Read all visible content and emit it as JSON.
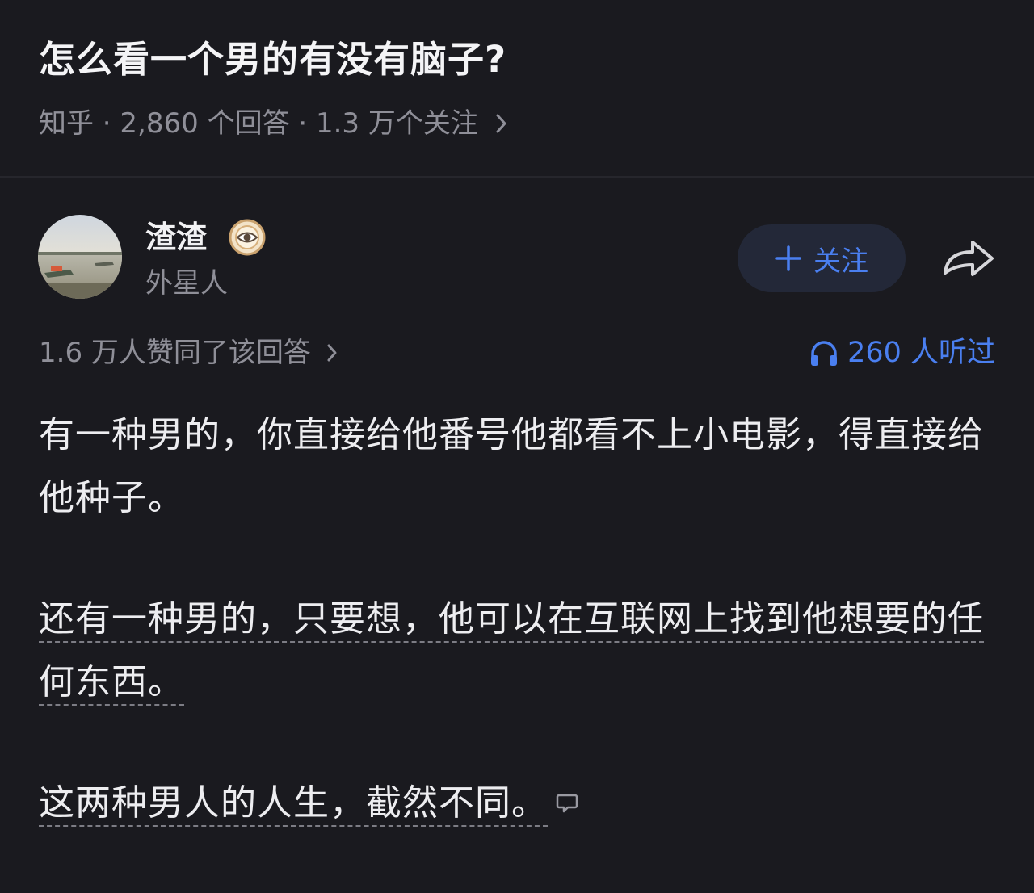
{
  "question": {
    "title": "怎么看一个男的有没有脑子?",
    "meta": "知乎 · 2,860 个回答 · 1.3 万个关注"
  },
  "author": {
    "name": "渣渣",
    "bio": "外星人"
  },
  "actions": {
    "follow_label": "关注"
  },
  "stats": {
    "agree": "1.6 万人赞同了该回答",
    "listen": "260 人听过"
  },
  "answer": {
    "paragraph1": "有一种男的，你直接给他番号他都看不上小电影，得直接给他种子。",
    "paragraph2": "还有一种男的，只要想，他可以在互联网上找到他想要的任何东西。",
    "paragraph3": "这两种男人的人生，截然不同。"
  },
  "colors": {
    "background": "#1a1a1f",
    "accent": "#4a7ff0",
    "muted": "#8f8f98",
    "follow_bg": "#232838"
  },
  "icons": {
    "meta_chevron": "chevron-right-icon",
    "badge": "eye-badge-icon",
    "follow": "plus-icon",
    "share": "share-arrow-icon",
    "listen": "headphones-icon",
    "comment": "comment-bubble-icon"
  }
}
